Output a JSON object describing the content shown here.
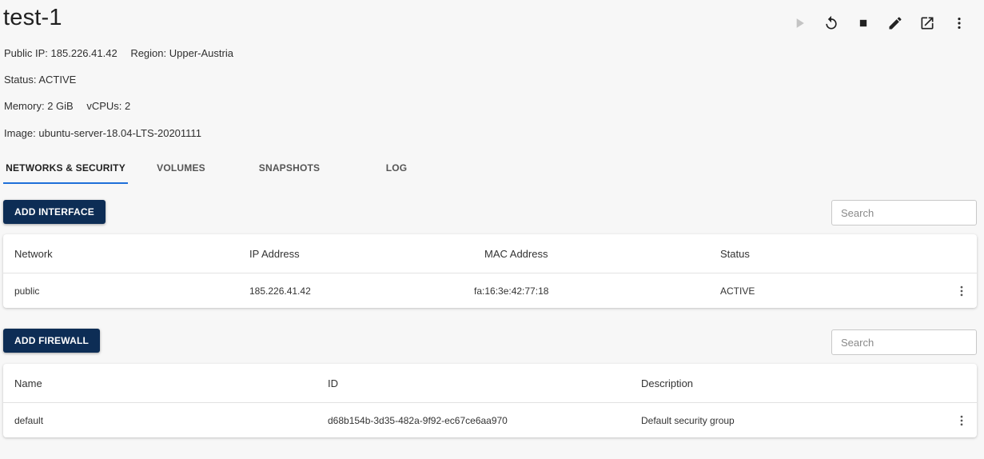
{
  "server": {
    "name": "test-1",
    "public_ip_label": "Public IP:",
    "public_ip": "185.226.41.42",
    "region_label": "Region:",
    "region": "Upper-Austria",
    "status_label": "Status:",
    "status": "ACTIVE",
    "memory_label": "Memory:",
    "memory": "2 GiB",
    "vcpus_label": "vCPUs:",
    "vcpus": "2",
    "image_label": "Image:",
    "image": "ubuntu-server-18.04-LTS-20201111"
  },
  "toolbar_icons": [
    "play-icon",
    "restart-icon",
    "stop-icon",
    "edit-icon",
    "open-external-icon",
    "more-vert-icon"
  ],
  "tabs": [
    {
      "label": "NETWORKS & SECURITY",
      "active": true
    },
    {
      "label": "VOLUMES",
      "active": false
    },
    {
      "label": "SNAPSHOTS",
      "active": false
    },
    {
      "label": "LOG",
      "active": false
    }
  ],
  "interfaces": {
    "button_label": "ADD INTERFACE",
    "search_placeholder": "Search",
    "columns": [
      "Network",
      "IP Address",
      "MAC Address",
      "Status"
    ],
    "rows": [
      [
        "public",
        "185.226.41.42",
        "fa:16:3e:42:77:18",
        "ACTIVE"
      ]
    ]
  },
  "firewalls": {
    "button_label": "ADD FIREWALL",
    "search_placeholder": "Search",
    "columns": [
      "Name",
      "ID",
      "Description"
    ],
    "rows": [
      [
        "default",
        "d68b154b-3d35-482a-9f92-ec67ce6aa970",
        "Default security group"
      ]
    ]
  },
  "colors": {
    "primary_button": "#0d2d55",
    "active_tab_indicator": "#1e6fd9",
    "background": "#f7f7f7"
  }
}
